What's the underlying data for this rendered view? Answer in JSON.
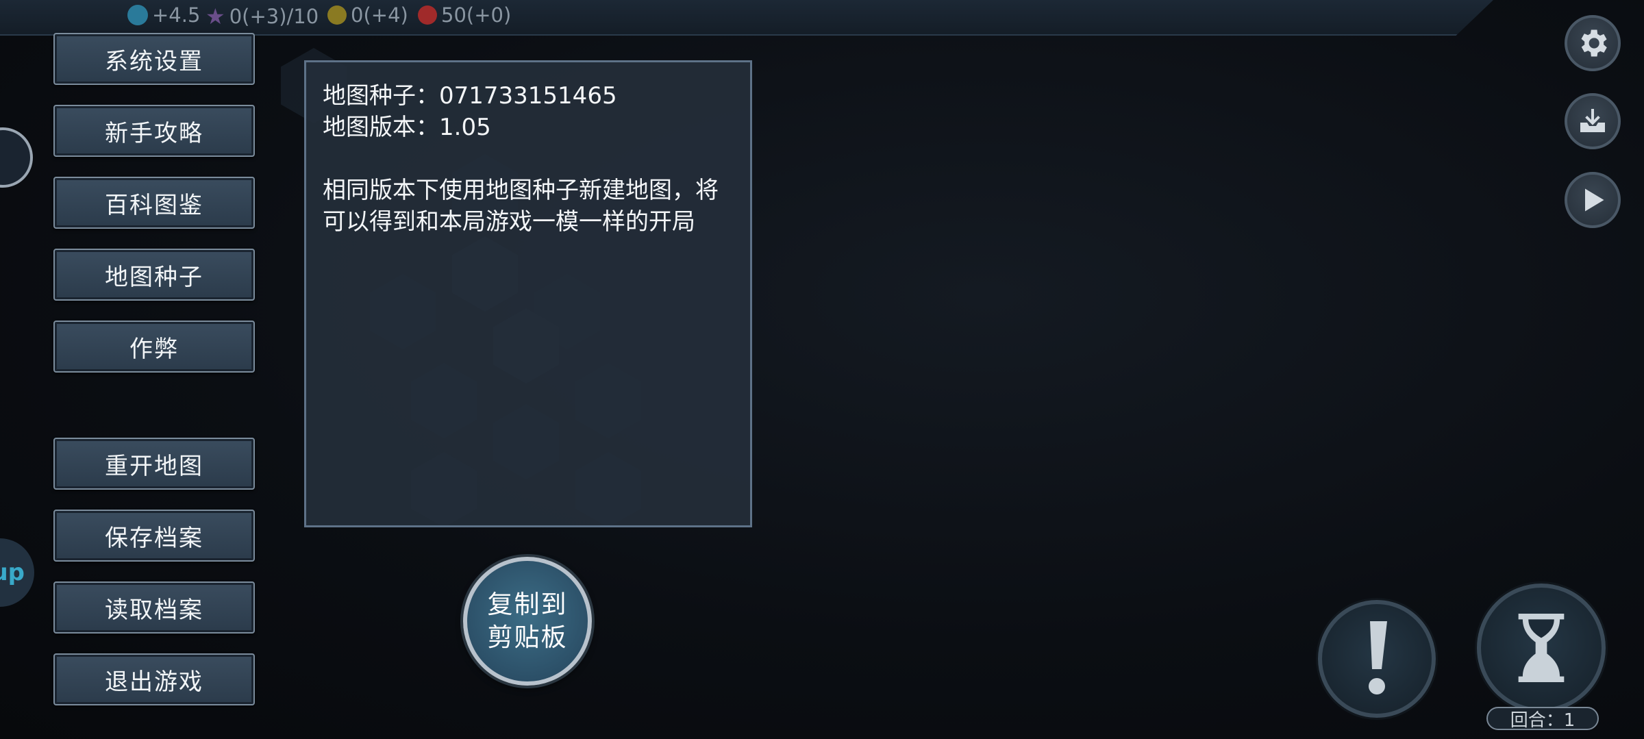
{
  "top_bar": {
    "resources": [
      {
        "icon": "science-icon",
        "value": "+4.5"
      },
      {
        "icon": "star-icon",
        "value": "0(+3)/10"
      },
      {
        "icon": "coin-icon",
        "value": "0(+4)"
      },
      {
        "icon": "population-icon",
        "value": "50(+0)"
      }
    ]
  },
  "menu": {
    "items": [
      {
        "label": "系统设置"
      },
      {
        "label": "新手攻略"
      },
      {
        "label": "百科图鉴"
      },
      {
        "label": "地图种子"
      },
      {
        "label": "作弊"
      },
      {
        "label": "重开地图"
      },
      {
        "label": "保存档案"
      },
      {
        "label": "读取档案"
      },
      {
        "label": "退出游戏"
      }
    ]
  },
  "side_badge": {
    "text": "up"
  },
  "panel": {
    "seed_line": "地图种子：071733151465",
    "version_line": "地图版本：1.05",
    "description_line1": "相同版本下使用地图种子新建地图，将",
    "description_line2": "可以得到和本局游戏一模一样的开局"
  },
  "copy_button": {
    "line1": "复制到",
    "line2": "剪贴板"
  },
  "right_controls": {
    "settings_icon": "gear-icon",
    "save_icon": "download-tray-icon",
    "play_icon": "play-icon",
    "alert_icon": "exclamation-icon",
    "end_turn_icon": "hourglass-icon",
    "turn_label": "回合：1"
  },
  "colors": {
    "menu_button": "#2f4050",
    "panel_bg": "#242e3a",
    "copy_button": "#2c5068",
    "accent_cyan": "#39a9c9"
  }
}
